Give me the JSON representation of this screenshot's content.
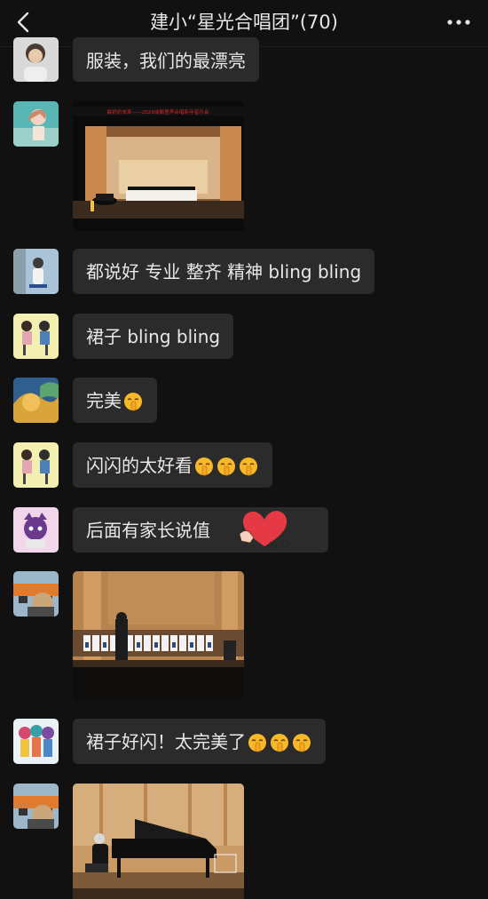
{
  "header": {
    "title": "建小“星光合唱团”(70)"
  },
  "messages": {
    "m1": {
      "text": "服装，我们的最漂亮"
    },
    "m2": {
      "banner": "最好的未来——2026成都童声合唱新年音乐会"
    },
    "m3": {
      "text": "都说好 专业 整齐 精神 bling bling"
    },
    "m4": {
      "text": "裙子 bling bling"
    },
    "m5": {
      "text": "完美"
    },
    "m6": {
      "text": "闪闪的太好看"
    },
    "m7": {
      "text": "后面有家长说值",
      "sticker_text": "比心"
    },
    "m10": {
      "text": "裙子好闪！太完美了"
    }
  },
  "icons": {
    "back": "chevron-left-icon",
    "more": "more-dots-icon",
    "emoji": "shushing-face-emoji"
  },
  "colors": {
    "bg": "#111111",
    "bubble": "#2b2b2b",
    "text": "#e8e8e8",
    "sticker": "#e63946"
  }
}
